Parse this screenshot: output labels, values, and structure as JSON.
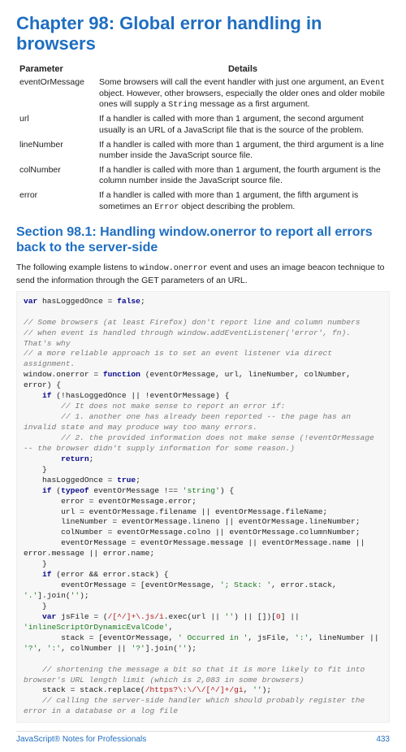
{
  "chapter_title": "Chapter 98: Global error handling in browsers",
  "table": {
    "headers": [
      "Parameter",
      "Details"
    ],
    "rows": [
      {
        "param": "eventOrMessage",
        "details_pre": "Some browsers will call the event handler with just one argument, an ",
        "c1": "Event",
        "details_mid": " object. However, other browsers, especially the older ones and older mobile ones will supply a ",
        "c2": "String",
        "details_post": " message as a first argument."
      },
      {
        "param": "url",
        "details": "If a handler is called with more than 1 argument, the second argument usually is an URL of a JavaScript file that is the source of the problem."
      },
      {
        "param": "lineNumber",
        "details": "If a handler is called with more than 1 argument, the third argument is a line number inside the JavaScript source file."
      },
      {
        "param": "colNumber",
        "details": "If a handler is called with more than 1 argument, the fourth argument is the column number inside the JavaScript source file."
      },
      {
        "param": "error",
        "details_pre": "If a handler is called with more than 1 argument, the fifth argument is sometimes an ",
        "c1": "Error",
        "details_post": " object describing the problem."
      }
    ]
  },
  "section_title": "Section 98.1: Handling window.onerror to report all errors back to the server-side",
  "intro_pre": "The following example listens to ",
  "intro_code": "window.onerror",
  "intro_post": " event and uses an image beacon technique to send the information through the GET parameters of an URL.",
  "code": {
    "l1_a": "var",
    "l1_b": " hasLoggedOnce = ",
    "l1_c": "false",
    "l1_d": ";",
    "c1": "// Some browsers (at least Firefox) don't report line and column numbers",
    "c2": "// when event is handled through window.addEventListener('error', fn). That's why",
    "c3": "// a more reliable approach is to set an event listener via direct assignment.",
    "l2_a": "window.onerror = ",
    "l2_b": "function",
    "l2_c": " (eventOrMessage, url, lineNumber, colNumber, error) {",
    "l3_a": "    ",
    "l3_b": "if",
    "l3_c": " (!hasLoggedOnce || !eventOrMessage) {",
    "c4": "        // It does not make sense to report an error if:",
    "c5": "        // 1. another one has already been reported -- the page has an invalid state and may produce way too many errors.",
    "c6": "        // 2. the provided information does not make sense (!eventOrMessage -- the browser didn't supply information for some reason.)",
    "l4_a": "        ",
    "l4_b": "return",
    "l4_c": ";",
    "l5": "    }",
    "l6_a": "    hasLoggedOnce = ",
    "l6_b": "true",
    "l6_c": ";",
    "l7_a": "    ",
    "l7_b": "if",
    "l7_c": " (",
    "l7_d": "typeof",
    "l7_e": " eventOrMessage !== ",
    "l7_f": "'string'",
    "l7_g": ") {",
    "l8": "        error = eventOrMessage.error;",
    "l9": "        url = eventOrMessage.filename || eventOrMessage.fileName;",
    "l10": "        lineNumber = eventOrMessage.lineno || eventOrMessage.lineNumber;",
    "l11": "        colNumber = eventOrMessage.colno || eventOrMessage.columnNumber;",
    "l12": "        eventOrMessage = eventOrMessage.message || eventOrMessage.name || error.message || error.name;",
    "l13": "    }",
    "l14_a": "    ",
    "l14_b": "if",
    "l14_c": " (error && error.stack) {",
    "l15_a": "        eventOrMessage = [eventOrMessage, ",
    "l15_b": "'; Stack: '",
    "l15_c": ", error.stack, ",
    "l15_d": "'.'",
    "l15_e": "].join(",
    "l15_f": "''",
    "l15_g": ");",
    "l16": "    }",
    "l17_a": "    ",
    "l17_b": "var",
    "l17_c": " jsFile = (",
    "l17_d": "/[^/]+\\.js/i",
    "l17_e": ".exec(url || ",
    "l17_f": "''",
    "l17_g": ") || [])[",
    "l17_h": "0",
    "l17_i": "] || ",
    "l17_j": "'inlineScriptOrDynamicEvalCode'",
    "l17_k": ",",
    "l18_a": "        stack = [eventOrMessage, ",
    "l18_b": "' Occurred in '",
    "l18_c": ", jsFile, ",
    "l18_d": "':'",
    "l18_e": ", lineNumber || ",
    "l18_f": "'?'",
    "l18_g": ", ",
    "l18_h": "':'",
    "l18_i": ", colNumber || ",
    "l18_j": "'?'",
    "l18_k": "].join(",
    "l18_l": "''",
    "l18_m": ");",
    "c7": "    // shortening the message a bit so that it is more likely to fit into browser's URL length limit (which is 2,083 in some browsers)",
    "l19_a": "    stack = stack.replace(",
    "l19_b": "/https?\\:\\/\\/[^/]+/gi",
    "l19_c": ", ",
    "l19_d": "''",
    "l19_e": ");",
    "c8": "    // calling the server-side handler which should probably register the error in a database or a log file"
  },
  "footer_left": "JavaScript® Notes for Professionals",
  "footer_right": "433"
}
